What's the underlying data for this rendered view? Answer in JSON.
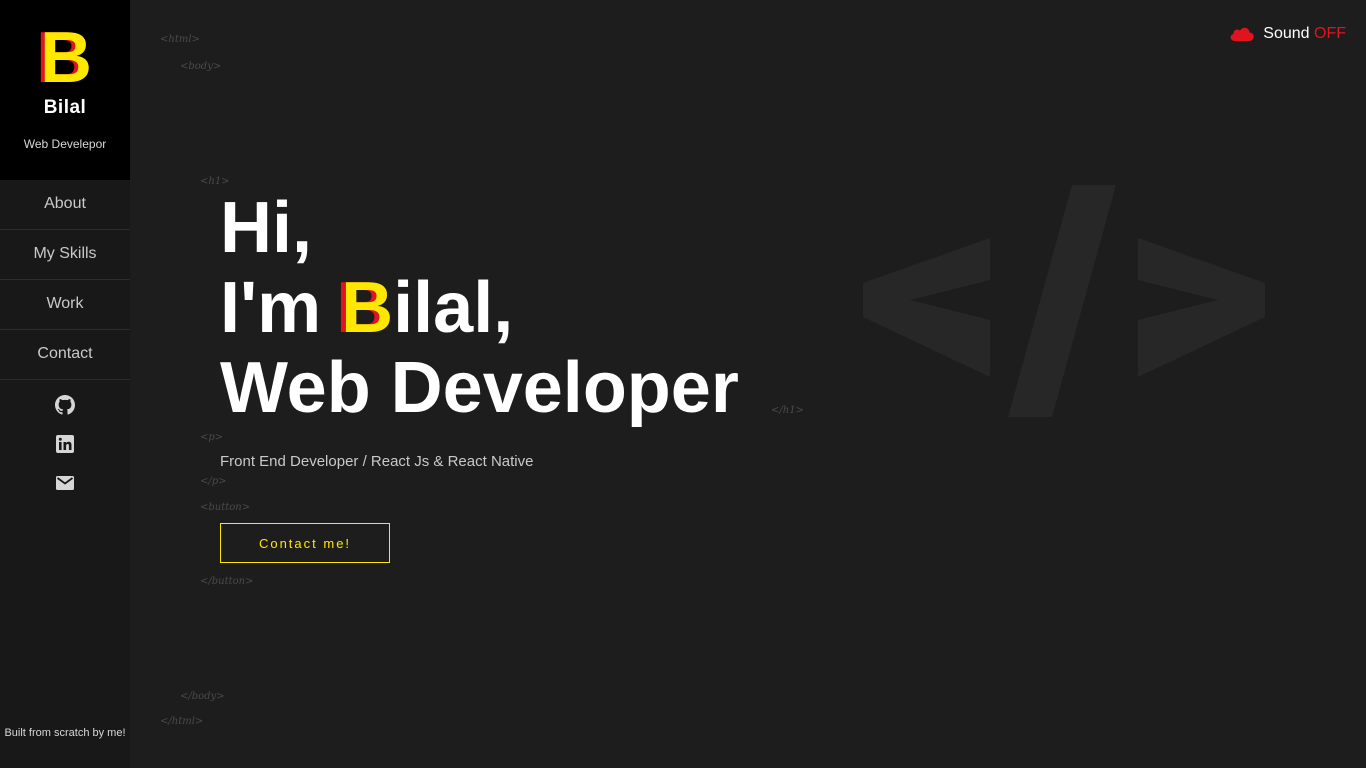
{
  "brand": {
    "logo_letter": "B",
    "name": "Bilal",
    "role": "Web Develepor"
  },
  "nav": [
    {
      "label": "About"
    },
    {
      "label": "My Skills"
    },
    {
      "label": "Work"
    },
    {
      "label": "Contact"
    }
  ],
  "socials": [
    {
      "icon": "github-icon"
    },
    {
      "icon": "linkedin-icon"
    },
    {
      "icon": "mail-icon"
    }
  ],
  "footer_note": "Built from scratch by me!",
  "sound": {
    "label": "Sound",
    "state": "OFF"
  },
  "tags": {
    "html_open": "<html>",
    "body_open": "<body>",
    "h1_open": "<h1>",
    "h1_close": "</h1>",
    "p_open": "<p>",
    "p_close": "</p>",
    "button_open": "<button>",
    "button_close": "</button>",
    "body_close": "</body>",
    "html_close": "</html>"
  },
  "hero": {
    "line1": "Hi,",
    "line2_prefix": "I'm ",
    "line2_letter": "B",
    "line2_suffix": "ilal,",
    "line3": "Web Developer"
  },
  "subtitle": "Front End Developer / React Js & React Native",
  "cta_label": "Contact me!",
  "colors": {
    "accent_yellow": "#ffe800",
    "accent_red": "#e0141e",
    "background": "#1d1d1d",
    "sidebar": "#181818"
  }
}
